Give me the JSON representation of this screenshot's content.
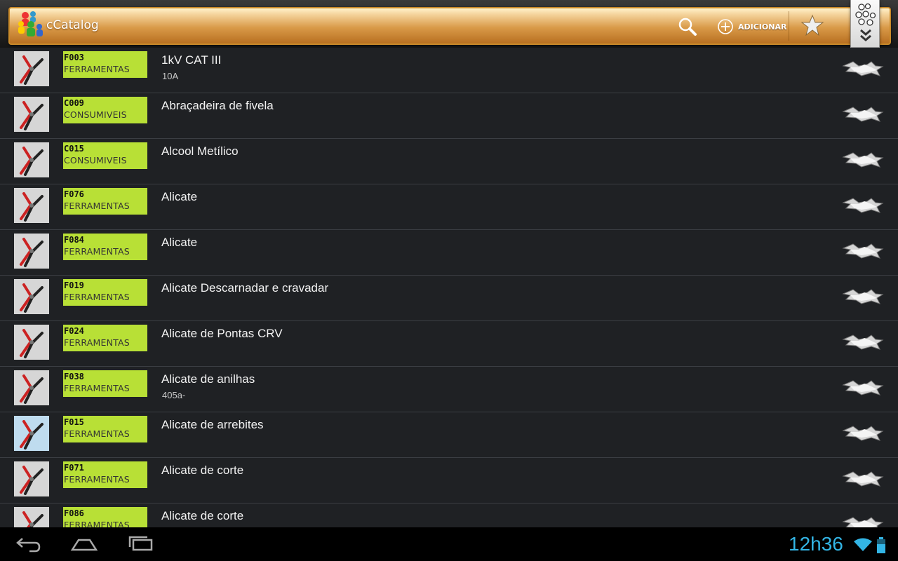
{
  "app": {
    "title": "cCatalog",
    "add_label": "ADICIONAR"
  },
  "colors": {
    "tag_bg": "#b8e036",
    "list_bg": "#1f2124",
    "clock": "#33b5e5",
    "action_bar": "#d99a48"
  },
  "icons": {
    "logo": "people-group-icon",
    "search": "search-icon",
    "add": "add-circle-icon",
    "favorites": "star-icon",
    "overflow": "people-chevron-icon",
    "row_action": "star-pair-icon"
  },
  "items": [
    {
      "code": "F003",
      "category": "FERRAMENTAS",
      "title": "1kV CAT III",
      "subtitle": "10A"
    },
    {
      "code": "C009",
      "category": "CONSUMIVEIS",
      "title": "Abraçadeira de fivela",
      "subtitle": ""
    },
    {
      "code": "C015",
      "category": "CONSUMIVEIS",
      "title": "Alcool Metílico",
      "subtitle": ""
    },
    {
      "code": "F076",
      "category": "FERRAMENTAS",
      "title": "Alicate",
      "subtitle": ""
    },
    {
      "code": "F084",
      "category": "FERRAMENTAS",
      "title": "Alicate",
      "subtitle": ""
    },
    {
      "code": "F019",
      "category": "FERRAMENTAS",
      "title": "Alicate Descarnadar e cravadar",
      "subtitle": ""
    },
    {
      "code": "F024",
      "category": "FERRAMENTAS",
      "title": "Alicate de Pontas CRV",
      "subtitle": ""
    },
    {
      "code": "F038",
      "category": "FERRAMENTAS",
      "title": "Alicate de anilhas",
      "subtitle": "405a-"
    },
    {
      "code": "F015",
      "category": "FERRAMENTAS",
      "title": "Alicate de arrebites",
      "subtitle": ""
    },
    {
      "code": "F071",
      "category": "FERRAMENTAS",
      "title": "Alicate de corte",
      "subtitle": ""
    },
    {
      "code": "F086",
      "category": "FERRAMENTAS",
      "title": "Alicate de corte",
      "subtitle": ""
    }
  ],
  "status": {
    "time": "12h36"
  }
}
